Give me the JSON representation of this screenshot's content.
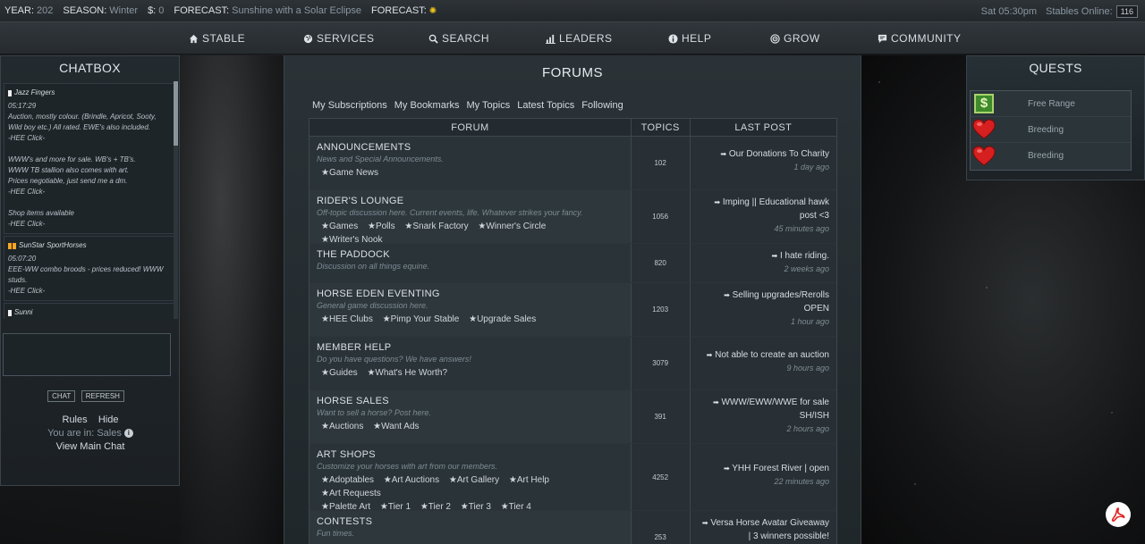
{
  "status_bar": {
    "year_label": "YEAR:",
    "year": "202",
    "season_label": "SEASON:",
    "season": "Winter",
    "money_label": "$:",
    "money": "0",
    "forecast_label": "FORECAST:",
    "forecast": "Sunshine with a Solar Eclipse",
    "forecast2_label": "FORECAST:",
    "forecast2_icon": "sun-icon",
    "time": "Sat 05:30pm",
    "stables_label": "Stables Online:",
    "stables_online": "116"
  },
  "nav": {
    "items": [
      {
        "label": "STABLE",
        "icon": "home-icon"
      },
      {
        "label": "SERVICES",
        "icon": "globe-icon"
      },
      {
        "label": "SEARCH",
        "icon": "search-icon"
      },
      {
        "label": "LEADERS",
        "icon": "bar-chart-icon"
      },
      {
        "label": "HELP",
        "icon": "info-icon"
      },
      {
        "label": "GROW",
        "icon": "target-icon"
      },
      {
        "label": "COMMUNITY",
        "icon": "chat-icon"
      }
    ]
  },
  "chatbox": {
    "title": "CHATBOX",
    "messages": [
      {
        "author": "Jazz Fingers",
        "time": "05:17:29",
        "lines": [
          "Auction, mostly colour. (Brindle, Apricot, Sooty, Wild boy etc.) All rated. EWE's also included.",
          "-HEE Click-",
          "",
          "WWW's and more for sale. WB's + TB's.",
          "WWW TB stallion also comes with art.",
          "Prices negotiable, just send me a dm.",
          "-HEE Click-",
          "",
          "Shop items available",
          "-HEE Click-"
        ]
      },
      {
        "author": "SunStar SportHorses",
        "time": "05:07:20",
        "lines": [
          "EEE-WW combo broods - prices reduced! WWW studs.",
          "-HEE Click-"
        ]
      },
      {
        "author": "Sunni",
        "time": "",
        "lines": []
      }
    ],
    "chat_button": "CHAT",
    "refresh_button": "REFRESH",
    "rules_link": "Rules",
    "hide_link": "Hide",
    "location_text": "You are in: Sales",
    "view_main_chat": "View Main Chat"
  },
  "forums": {
    "title": "FORUMS",
    "tabs": [
      "My Subscriptions",
      "My Bookmarks",
      "My Topics",
      "Latest Topics",
      "Following"
    ],
    "headers": {
      "forum": "FORUM",
      "topics": "TOPICS",
      "last_post": "LAST POST"
    },
    "rows": [
      {
        "name": "ANNOUNCEMENTS",
        "desc": "News and Special Announcements.",
        "subs": [
          "★Game News"
        ],
        "topics": "102",
        "last_post": "Our Donations To Charity",
        "last_time": "1 day ago"
      },
      {
        "name": "RIDER'S LOUNGE",
        "desc": "Off-topic discussion here. Current events, life. Whatever strikes your fancy.",
        "subs": [
          "★Games",
          "★Polls",
          "★Snark Factory",
          "★Winner's Circle",
          "★Writer's Nook"
        ],
        "topics": "1056",
        "last_post": "Imping || Educational hawk post <3",
        "last_time": "45 minutes ago"
      },
      {
        "name": "THE PADDOCK",
        "desc": "Discussion on all things equine.",
        "subs": [],
        "topics": "820",
        "last_post": "I hate riding.",
        "last_time": "2 weeks ago"
      },
      {
        "name": "HORSE EDEN EVENTING",
        "desc": "General game discussion here.",
        "subs": [
          "★HEE Clubs",
          "★Pimp Your Stable",
          "★Upgrade Sales"
        ],
        "topics": "1203",
        "last_post": "Selling upgrades/Rerolls OPEN",
        "last_time": "1 hour ago"
      },
      {
        "name": "MEMBER HELP",
        "desc": "Do you have questions? We have answers!",
        "subs": [
          "★Guides",
          "★What's He Worth?"
        ],
        "topics": "3079",
        "last_post": "Not able to create an auction",
        "last_time": "9 hours ago"
      },
      {
        "name": "HORSE SALES",
        "desc": "Want to sell a horse? Post here.",
        "subs": [
          "★Auctions",
          "★Want Ads"
        ],
        "topics": "391",
        "last_post": "WWW/EWW/WWE for sale SH/ISH",
        "last_time": "2 hours ago"
      },
      {
        "name": "ART SHOPS",
        "desc": "Customize your horses with art from our members.",
        "subs": [
          "★Adoptables",
          "★Art Auctions",
          "★Art Gallery",
          "★Art Help",
          "★Art Requests",
          "★Palette Art",
          "★Tier 1",
          "★Tier 2",
          "★Tier 3",
          "★Tier 4"
        ],
        "topics": "4252",
        "last_post": "YHH Forest River | open",
        "last_time": "22 minutes ago"
      },
      {
        "name": "CONTESTS",
        "desc": "Fun times.",
        "subs": [],
        "topics": "253",
        "last_post": "Versa Horse Avatar Giveaway | 3 winners possible!",
        "last_time": ""
      }
    ]
  },
  "quests": {
    "title": "QUESTS",
    "items": [
      {
        "label": "Free Range",
        "icon": "money-icon"
      },
      {
        "label": "Breeding",
        "icon": "heart-icon"
      },
      {
        "label": "Breeding",
        "icon": "heart-icon"
      }
    ]
  },
  "colors": {
    "accent": "#f0c419",
    "panel": "#232a2f",
    "text": "#c8d0d6"
  }
}
